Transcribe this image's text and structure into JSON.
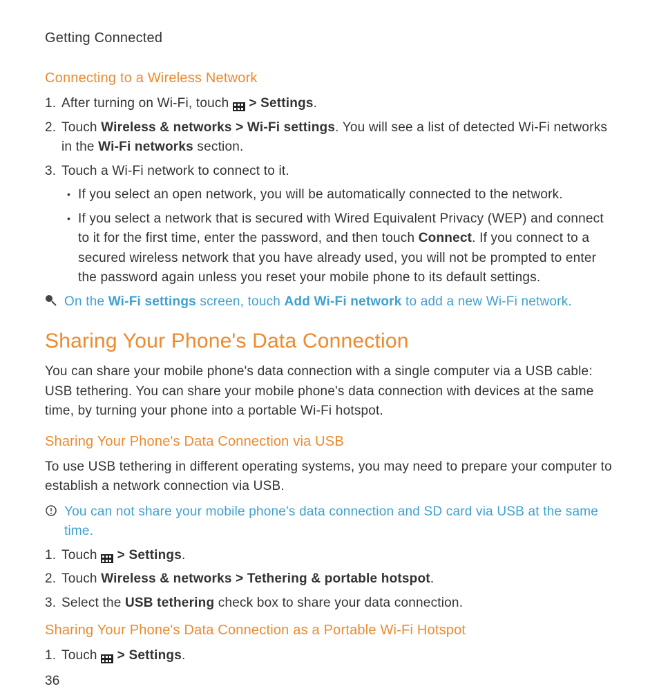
{
  "header": "Getting Connected",
  "s1": {
    "title": "Connecting to a Wireless Network",
    "li1a": "After turning on Wi-Fi, touch ",
    "li1b": " > Settings",
    "li1c": ".",
    "li2a": "Touch ",
    "li2b": "Wireless & networks > Wi-Fi settings",
    "li2c": ". You will see a list of detected Wi-Fi networks in the ",
    "li2d": "Wi-Fi networks",
    "li2e": " section.",
    "li3": "Touch a Wi-Fi network to connect to it.",
    "b1": "If you select an open network, you will be automatically connected to the network.",
    "b2a": "If you select a network that is secured with Wired Equivalent Privacy (WEP) and connect to it for the first time, enter the password, and then touch ",
    "b2b": "Connect",
    "b2c": ". If you connect to a secured wireless network that you have already used, you will not be prompted to enter the password again unless you reset your mobile phone to its default settings.",
    "tip_a": "On the ",
    "tip_b": "Wi-Fi settings",
    "tip_c": " screen, touch ",
    "tip_d": "Add Wi-Fi network",
    "tip_e": " to add a new Wi-Fi network."
  },
  "s2": {
    "title": "Sharing Your Phone's Data Connection",
    "para": "You can share your mobile phone's data connection with a single computer via a USB cable: USB tethering. You can share your mobile phone's data connection with devices at the same time, by turning your phone into a portable Wi-Fi hotspot."
  },
  "s3": {
    "title": "Sharing Your Phone's Data Connection via USB",
    "para": "To use USB tethering in different operating systems, you may need to prepare your computer to establish a network connection via USB.",
    "note": "You can not share your mobile phone's data connection and SD card via USB at the same time.",
    "li1a": "Touch ",
    "li1b": " > Settings",
    "li1c": ".",
    "li2a": "Touch ",
    "li2b": "Wireless & networks > Tethering & portable hotspot",
    "li2c": ".",
    "li3a": "Select the ",
    "li3b": "USB tethering",
    "li3c": " check box to share your data connection."
  },
  "s4": {
    "title": "Sharing Your Phone's Data Connection as a Portable Wi-Fi Hotspot",
    "li1a": "Touch ",
    "li1b": " > Settings",
    "li1c": "."
  },
  "page_number": "36"
}
